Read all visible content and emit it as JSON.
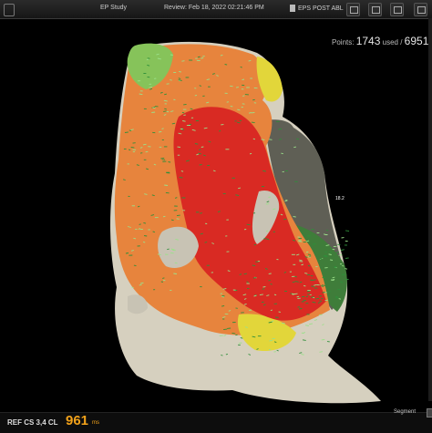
{
  "header": {
    "study": "EP Study",
    "review": "Review: Feb 18, 2022 02:21:46 PM",
    "map_name": "EPS POST ABL"
  },
  "toolbar_icons": [
    "view-icon",
    "snapshot-icon",
    "window-icon",
    "layout-icon"
  ],
  "points": {
    "label": "Points:",
    "used": "1743",
    "used_label": "used /",
    "total": "6951"
  },
  "map": {
    "annotation": "18.2",
    "colors": {
      "red": "#d92a23",
      "orange": "#e7843d",
      "yellow": "#e2d63a",
      "green": "#4c9a4a",
      "light_green": "#86c35a",
      "gray": "#c8c3b4",
      "dark_gray": "#5f5f55"
    }
  },
  "footer": {
    "ref_label": "REF CS 3,4 CL",
    "cl_value": "961",
    "cl_unit": "ms",
    "segment_label": "Segment"
  }
}
